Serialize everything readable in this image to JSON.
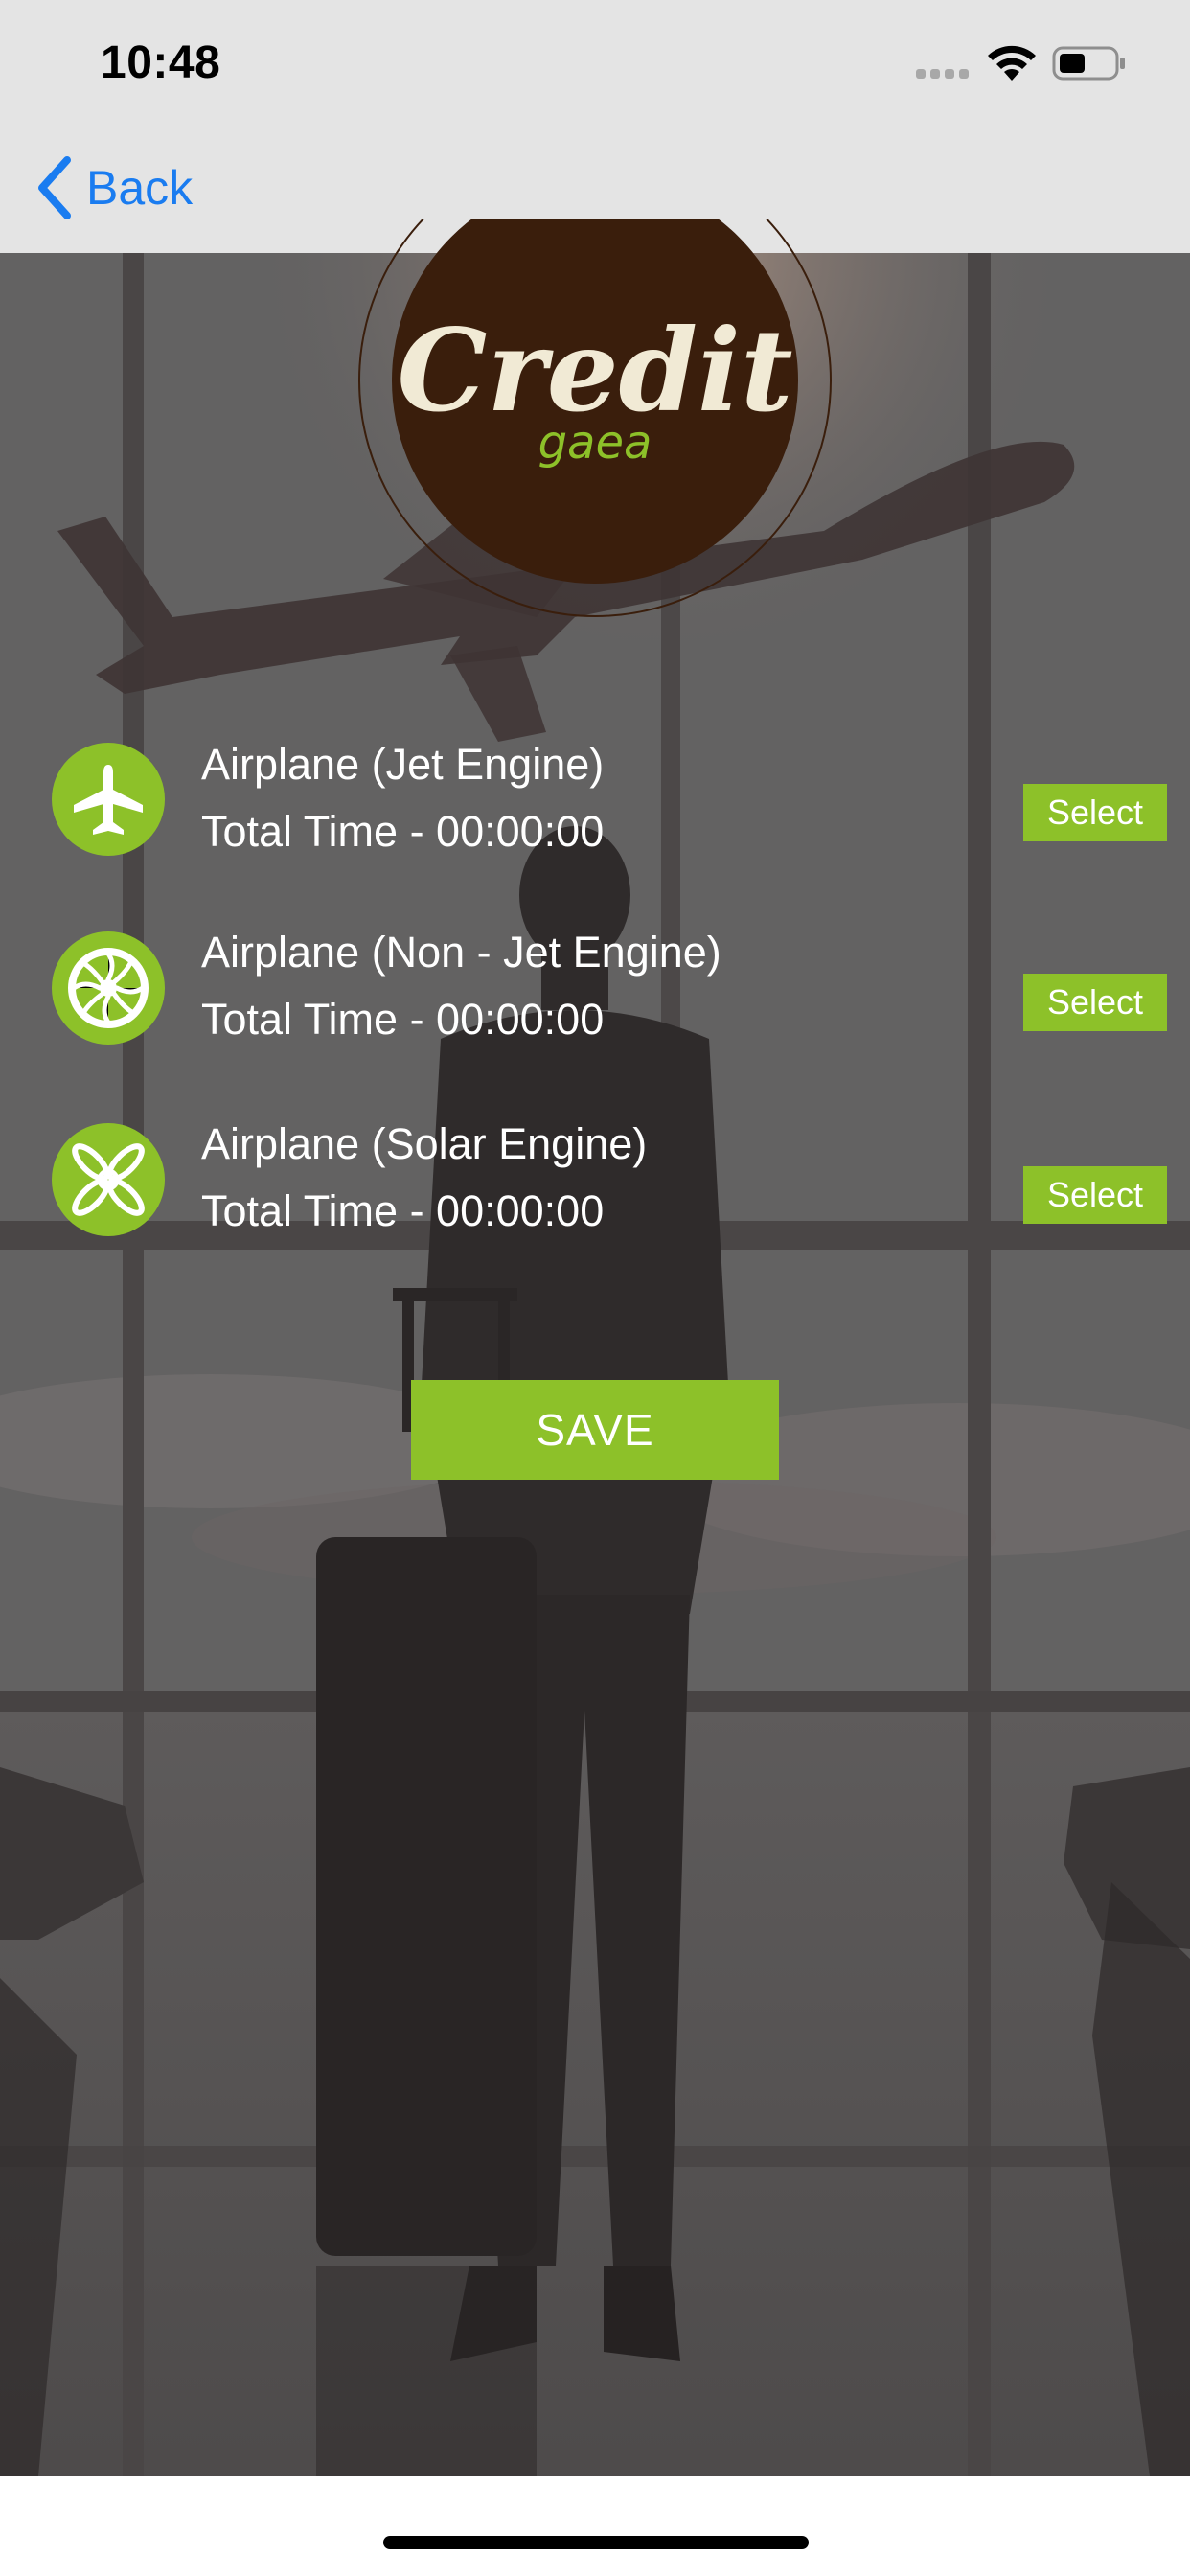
{
  "status_bar": {
    "time": "10:48"
  },
  "nav": {
    "back_label": "Back",
    "accent_color": "#1a7cf0"
  },
  "logo": {
    "wordmark": "Credit",
    "sub": "gaea"
  },
  "options": [
    {
      "title": "Airplane (Jet Engine)",
      "time": "Total Time - 00:00:00",
      "select_label": "Select",
      "icon": "airplane-icon"
    },
    {
      "title": "Airplane (Non - Jet Engine)",
      "time": "Total Time - 00:00:00",
      "select_label": "Select",
      "icon": "turbine-icon"
    },
    {
      "title": "Airplane (Solar Engine)",
      "time": "Total Time - 00:00:00",
      "select_label": "Select",
      "icon": "propeller-icon"
    }
  ],
  "save_label": "SAVE",
  "colors": {
    "brand_green": "#8dc129",
    "logo_brown": "#3a1e0c"
  }
}
